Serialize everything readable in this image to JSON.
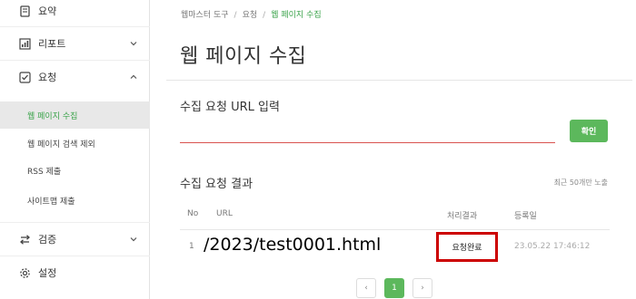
{
  "sidebar": {
    "items": [
      {
        "label": "요약",
        "icon": "document-icon"
      },
      {
        "label": "리포트",
        "icon": "bar-chart-icon"
      },
      {
        "label": "요청",
        "icon": "checkbox-icon"
      },
      {
        "label": "검증",
        "icon": "sync-icon"
      },
      {
        "label": "설정",
        "icon": "gear-icon"
      }
    ],
    "sub_items": [
      {
        "label": "웹 페이지 수집",
        "active": true
      },
      {
        "label": "웹 페이지 검색 제외",
        "active": false
      },
      {
        "label": "RSS 제출",
        "active": false
      },
      {
        "label": "사이트맵 제출",
        "active": false
      }
    ]
  },
  "breadcrumb": [
    "웹마스터 도구",
    "요청",
    "웹 페이지 수집"
  ],
  "breadcrumb_separator": "/",
  "page_title": "웹 페이지 수집",
  "url_form": {
    "label": "수집 요청 URL 입력",
    "value": "",
    "button_label": "확인"
  },
  "results": {
    "title": "수집 요청 결과",
    "note": "최근 50개만 노출",
    "columns": [
      "No",
      "URL",
      "처리결과",
      "등록일"
    ],
    "rows": [
      {
        "no": "1",
        "url": "/2023/test0001.html",
        "status": "요청완료",
        "date": "23.05.22 17:46:12"
      }
    ]
  },
  "pagination": {
    "prev": "‹",
    "current": "1",
    "next": "›"
  },
  "colors": {
    "accent": "#3aa34a",
    "button": "#5cb85c",
    "highlight_box": "#cc0000",
    "input_underline": "#d9534f"
  }
}
